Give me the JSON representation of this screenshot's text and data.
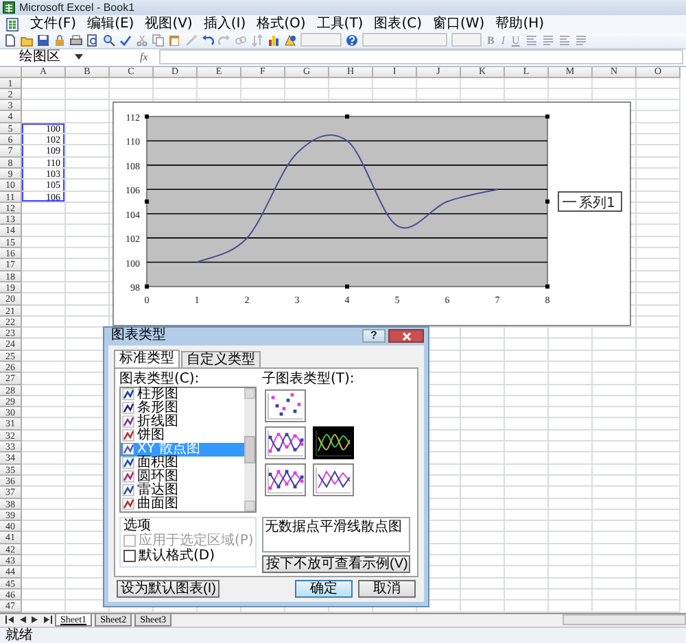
{
  "window": {
    "title": "Microsoft Excel - Book1"
  },
  "menu": [
    "文件(F)",
    "编辑(E)",
    "视图(V)",
    "插入(I)",
    "格式(O)",
    "工具(T)",
    "图表(C)",
    "窗口(W)",
    "帮助(H)"
  ],
  "toolbar": {
    "format_buttons": [
      "B",
      "I",
      "U"
    ]
  },
  "formula_bar": {
    "name_box": "绘图区",
    "fx": "fx"
  },
  "sheet": {
    "columns": [
      "A",
      "B",
      "C",
      "D",
      "E",
      "F",
      "G",
      "H",
      "I",
      "J",
      "K",
      "L",
      "M",
      "N",
      "O"
    ],
    "rows": [
      {
        "header": "1"
      },
      {
        "header": "2"
      },
      {
        "header": "3"
      },
      {
        "header": "4"
      },
      {
        "header": "5",
        "cells": [
          "100"
        ]
      },
      {
        "header": "6",
        "cells": [
          "102"
        ]
      },
      {
        "header": "7",
        "cells": [
          "109"
        ]
      },
      {
        "header": "8",
        "cells": [
          "110"
        ]
      },
      {
        "header": "9",
        "cells": [
          "103"
        ]
      },
      {
        "header": "10",
        "cells": [
          "105"
        ]
      },
      {
        "header": "11",
        "cells": [
          "106"
        ]
      },
      {
        "header": "12"
      },
      {
        "header": "13"
      },
      {
        "header": "14"
      },
      {
        "header": "15"
      },
      {
        "header": "16"
      },
      {
        "header": "17"
      },
      {
        "header": "18"
      },
      {
        "header": "19"
      },
      {
        "header": "20"
      },
      {
        "header": "21"
      },
      {
        "header": "22"
      },
      {
        "header": "23"
      },
      {
        "header": "24"
      },
      {
        "header": "25"
      },
      {
        "header": "26"
      },
      {
        "header": "27"
      },
      {
        "header": "28"
      },
      {
        "header": "29"
      },
      {
        "header": "30"
      },
      {
        "header": "31"
      },
      {
        "header": "32"
      },
      {
        "header": "33"
      },
      {
        "header": "34"
      },
      {
        "header": "35"
      },
      {
        "header": "36"
      },
      {
        "header": "37"
      },
      {
        "header": "38"
      },
      {
        "header": "39"
      },
      {
        "header": "40"
      },
      {
        "header": "41"
      },
      {
        "header": "42"
      },
      {
        "header": "43"
      },
      {
        "header": "44"
      },
      {
        "header": "45"
      },
      {
        "header": "46"
      },
      {
        "header": "47"
      }
    ]
  },
  "chart": {
    "chart_data": {
      "type": "line",
      "x": [
        1,
        2,
        3,
        4,
        5,
        6,
        7
      ],
      "series": [
        {
          "name": "系列1",
          "color": "#4b4b9b",
          "values": [
            100,
            102,
            109,
            110,
            103,
            105,
            106
          ]
        }
      ],
      "xlim": [
        0,
        8
      ],
      "ylim": [
        98,
        112
      ],
      "grid": true,
      "xticks": [
        0,
        1,
        2,
        3,
        4,
        5,
        6,
        7,
        8
      ],
      "yticks": [
        98,
        100,
        102,
        104,
        106,
        108,
        110,
        112
      ]
    }
  },
  "dialog": {
    "title": "图表类型",
    "help_button": "?",
    "tabs": [
      {
        "label": "标准类型",
        "selected": true
      },
      {
        "label": "自定义类型",
        "selected": false
      }
    ],
    "chart_types_label": "图表类型(C):",
    "chart_types": [
      {
        "label": "柱形图",
        "selected": false
      },
      {
        "label": "条形图",
        "selected": false
      },
      {
        "label": "折线图",
        "selected": false
      },
      {
        "label": "饼图",
        "selected": false
      },
      {
        "label": "XY 散点图",
        "selected": true
      },
      {
        "label": "面积图",
        "selected": false
      },
      {
        "label": "圆环图",
        "selected": false
      },
      {
        "label": "雷达图",
        "selected": false
      },
      {
        "label": "曲面图",
        "selected": false
      }
    ],
    "subtypes_label": "子图表类型(T):",
    "subtypes": [
      {
        "kind": "markers",
        "selected": false
      },
      {
        "kind": "smooth-markers",
        "selected": false
      },
      {
        "kind": "smooth",
        "selected": true
      },
      {
        "kind": "line-markers",
        "selected": false
      },
      {
        "kind": "line",
        "selected": false
      }
    ],
    "options_label": "选项",
    "options": [
      {
        "label": "应用于选定区域(P)",
        "checked": false,
        "disabled": true
      },
      {
        "label": "默认格式(D)",
        "checked": false,
        "disabled": false
      }
    ],
    "description": "无数据点平滑线散点图",
    "preview_button": "按下不放可查看示例(V)",
    "set_default_button": "设为默认图表(I)",
    "ok_button": "确定",
    "cancel_button": "取消"
  },
  "sheet_tabs": [
    {
      "label": "Sheet1",
      "selected": true
    },
    {
      "label": "Sheet2",
      "selected": false
    },
    {
      "label": "Sheet3",
      "selected": false
    }
  ],
  "status_bar": "就绪"
}
